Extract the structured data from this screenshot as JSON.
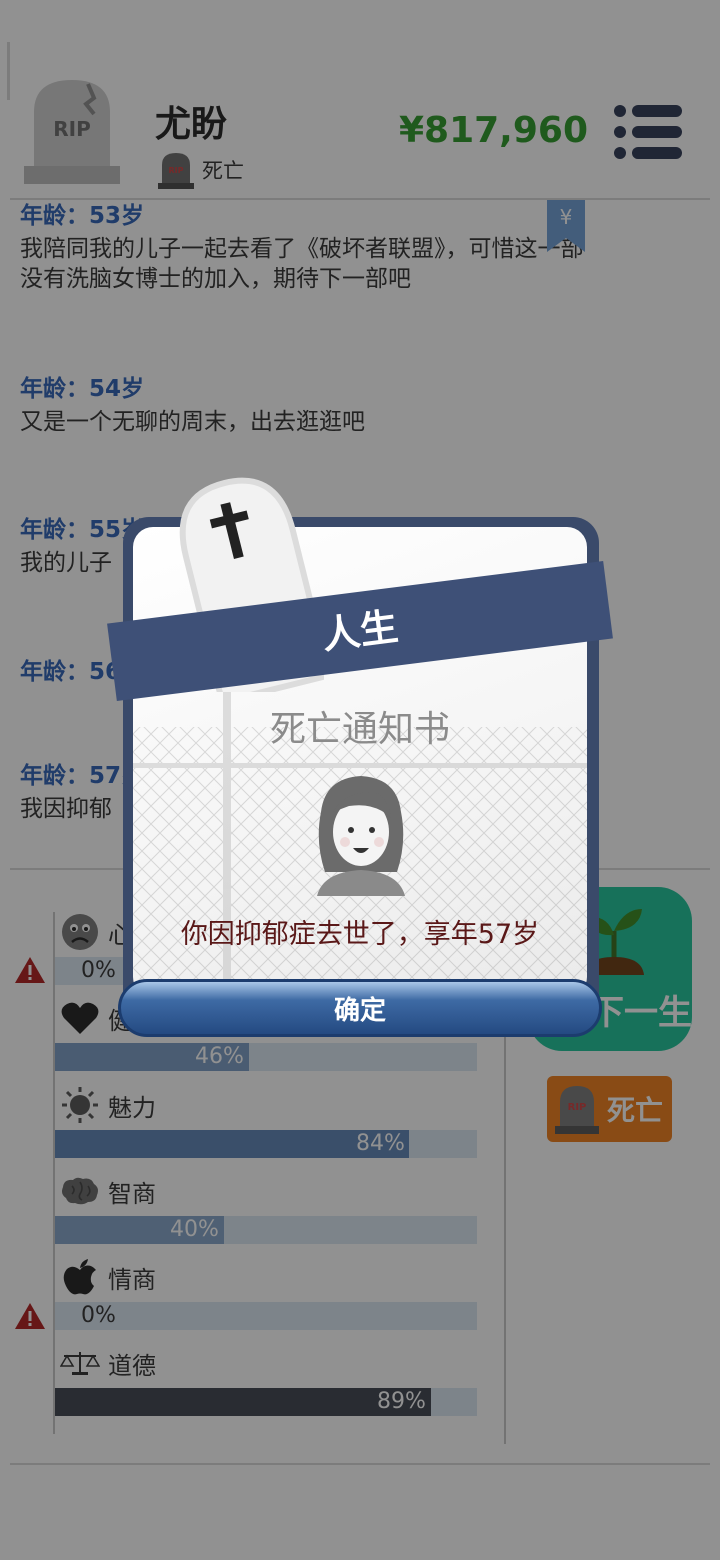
{
  "header": {
    "player_name": "尤盼",
    "status": "死亡",
    "money": "¥817,960",
    "rip_text": "RIP"
  },
  "log": [
    {
      "age": "年龄：53岁",
      "lines": [
        "我陪同我的儿子一起去看了《破坏者联盟》，可惜这一部",
        "没有洗脑女博士的加入，期待下一部吧"
      ]
    },
    {
      "age": "年龄：54岁",
      "lines": [
        "又是一个无聊的周末，出去逛逛吧"
      ]
    },
    {
      "age": "年龄：55岁",
      "lines": [
        "我的儿子"
      ]
    },
    {
      "age": "年龄：56岁",
      "lines": []
    },
    {
      "age": "年龄：57岁",
      "lines": [
        "我因抑郁"
      ]
    }
  ],
  "bookmark_symbol": "¥",
  "stats": [
    {
      "label": "心情",
      "value": 0,
      "text": "0%",
      "warning": true
    },
    {
      "label": "健康",
      "value": 46,
      "text": "46%",
      "warning": false
    },
    {
      "label": "魅力",
      "value": 84,
      "text": "84%",
      "warning": false
    },
    {
      "label": "智商",
      "value": 40,
      "text": "40%",
      "warning": false
    },
    {
      "label": "情商",
      "value": 0,
      "text": "0%",
      "warning": true
    },
    {
      "label": "道德",
      "value": 89,
      "text": "89%",
      "warning": false
    }
  ],
  "side_buttons": {
    "next_life_label": "下一生",
    "death_label": "死亡"
  },
  "dialog": {
    "banner_title": "人生",
    "heading": "死亡通知书",
    "message": "你因抑郁症去世了，享年57岁",
    "confirm_label": "确定"
  },
  "colors": {
    "money": "#2e9a2a",
    "age": "#2f63b8",
    "ribbon": "#3e5077",
    "death_button": "#f07f1b",
    "next_button": "#1ec49a"
  }
}
